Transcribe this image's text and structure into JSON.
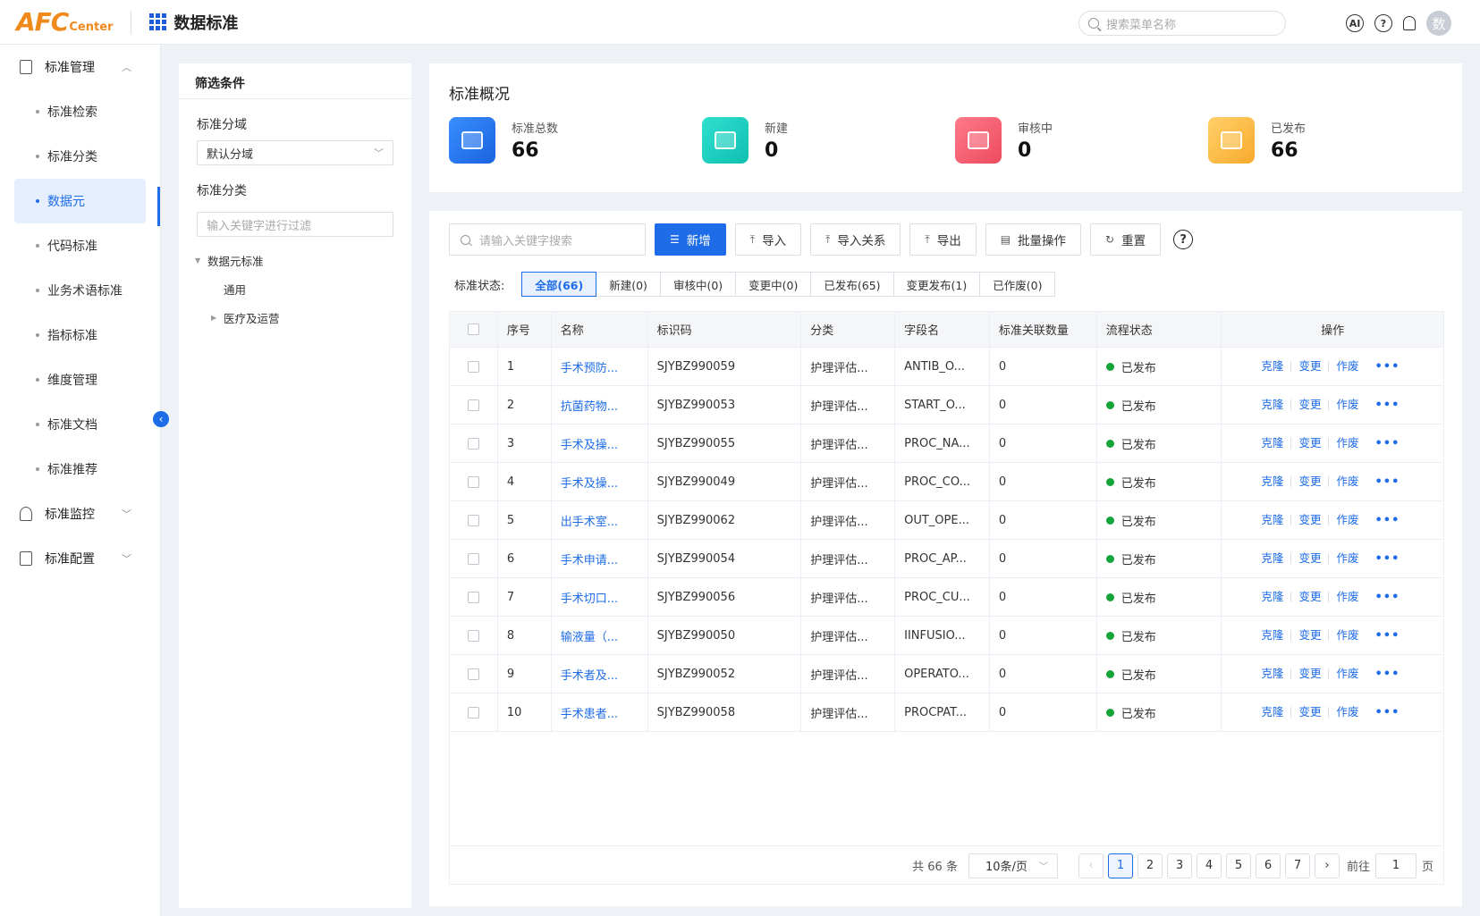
{
  "header": {
    "logo_main": "AFC",
    "logo_sub": "enter",
    "app_title": "数据标准",
    "search_placeholder": "搜索菜单名称",
    "ai_icon_label": "AI",
    "help_icon_label": "?",
    "avatar_text": "数"
  },
  "sidebar": {
    "groups": [
      {
        "label": "标准管理",
        "expanded": true
      },
      {
        "label": "标准监控",
        "expanded": false
      },
      {
        "label": "标准配置",
        "expanded": false
      }
    ],
    "items": [
      "标准检索",
      "标准分类",
      "数据元",
      "代码标准",
      "业务术语标准",
      "指标标准",
      "维度管理",
      "标准文档",
      "标准推荐"
    ],
    "active_item": "数据元"
  },
  "filter": {
    "title": "筛选条件",
    "domain_label": "标准分域",
    "domain_value": "默认分域",
    "category_label": "标准分类",
    "category_placeholder": "输入关键字进行过滤",
    "tree": [
      "数据元标准",
      "通用",
      "医疗及运营"
    ]
  },
  "overview": {
    "title": "标准概况",
    "stats": [
      {
        "label": "标准总数",
        "value": "66",
        "color": "#1a73e8"
      },
      {
        "label": "新建",
        "value": "0",
        "color": "#14c5b8"
      },
      {
        "label": "审核中",
        "value": "0",
        "color": "#f0566a"
      },
      {
        "label": "已发布",
        "value": "66",
        "color": "#fbb53a"
      }
    ]
  },
  "toolbar": {
    "search_placeholder": "请输入关键字搜索",
    "add": "新增",
    "import": "导入",
    "import_relation": "导入关系",
    "export": "导出",
    "batch": "批量操作",
    "reset": "重置",
    "help": "?"
  },
  "status_filter": {
    "label": "标准状态:",
    "options": [
      "全部(66)",
      "新建(0)",
      "审核中(0)",
      "变更中(0)",
      "已发布(65)",
      "变更发布(1)",
      "已作废(0)"
    ],
    "active": "全部(66)"
  },
  "table": {
    "columns": [
      "序号",
      "名称",
      "标识码",
      "分类",
      "字段名",
      "标准关联数量",
      "流程状态",
      "操作"
    ],
    "actions": [
      "克隆",
      "变更",
      "作废"
    ],
    "more": "•••",
    "rows": [
      {
        "no": "1",
        "name": "手术预防...",
        "code": "SJYBZ990059",
        "category": "护理评估...",
        "field": "ANTIB_O...",
        "count": "0",
        "status": "已发布"
      },
      {
        "no": "2",
        "name": "抗菌药物...",
        "code": "SJYBZ990053",
        "category": "护理评估...",
        "field": "START_O...",
        "count": "0",
        "status": "已发布"
      },
      {
        "no": "3",
        "name": "手术及操...",
        "code": "SJYBZ990055",
        "category": "护理评估...",
        "field": "PROC_NA...",
        "count": "0",
        "status": "已发布"
      },
      {
        "no": "4",
        "name": "手术及操...",
        "code": "SJYBZ990049",
        "category": "护理评估...",
        "field": "PROC_CO...",
        "count": "0",
        "status": "已发布"
      },
      {
        "no": "5",
        "name": "出手术室...",
        "code": "SJYBZ990062",
        "category": "护理评估...",
        "field": "OUT_OPE...",
        "count": "0",
        "status": "已发布"
      },
      {
        "no": "6",
        "name": "手术申请...",
        "code": "SJYBZ990054",
        "category": "护理评估...",
        "field": "PROC_AP...",
        "count": "0",
        "status": "已发布"
      },
      {
        "no": "7",
        "name": "手术切口...",
        "code": "SJYBZ990056",
        "category": "护理评估...",
        "field": "PROC_CU...",
        "count": "0",
        "status": "已发布"
      },
      {
        "no": "8",
        "name": "输液量（...",
        "code": "SJYBZ990050",
        "category": "护理评估...",
        "field": "IINFUSIO...",
        "count": "0",
        "status": "已发布"
      },
      {
        "no": "9",
        "name": "手术者及...",
        "code": "SJYBZ990052",
        "category": "护理评估...",
        "field": "OPERATO...",
        "count": "0",
        "status": "已发布"
      },
      {
        "no": "10",
        "name": "手术患者...",
        "code": "SJYBZ990058",
        "category": "护理评估...",
        "field": "PROCPAT...",
        "count": "0",
        "status": "已发布"
      }
    ]
  },
  "pagination": {
    "total": "共 66 条",
    "page_size": "10条/页",
    "pages": [
      "1",
      "2",
      "3",
      "4",
      "5",
      "6",
      "7"
    ],
    "current": "1",
    "goto_prefix": "前往",
    "goto_value": "1",
    "goto_suffix": "页"
  }
}
